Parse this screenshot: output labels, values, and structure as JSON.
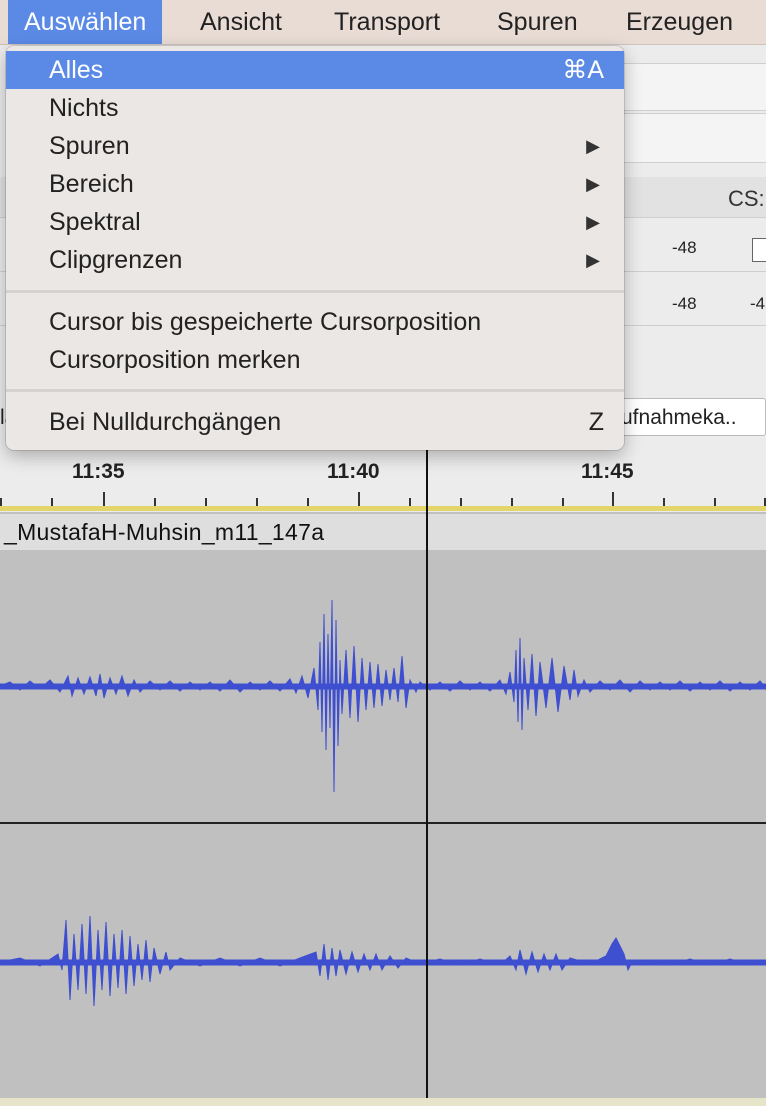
{
  "menubar": {
    "items": [
      {
        "label": "Auswählen",
        "active": true
      },
      {
        "label": "Ansicht"
      },
      {
        "label": "Transport"
      },
      {
        "label": "Spuren"
      },
      {
        "label": "Erzeugen"
      }
    ]
  },
  "dropdown": {
    "items": [
      {
        "label": "Alles",
        "shortcut": "⌘A",
        "highlighted": true
      },
      {
        "label": "Nichts"
      },
      {
        "label": "Spuren",
        "submenu": true
      },
      {
        "label": "Bereich",
        "submenu": true
      },
      {
        "label": "Spektral",
        "submenu": true
      },
      {
        "label": "Clipgrenzen",
        "submenu": true
      },
      {
        "label": "Cursor bis gespeicherte Cursorposition"
      },
      {
        "label": "Cursorposition merken"
      },
      {
        "label": "Bei Nulldurchgängen",
        "shortcut": "Z"
      }
    ],
    "submenu_arrow": "▶"
  },
  "toolbar": {
    "cs_label": "CS:",
    "meter_ticks": [
      "-48",
      "-48",
      "-4"
    ],
    "device_field": "ufnahmeka..",
    "left_fragment": "la"
  },
  "timeline": {
    "labels": [
      "11:35",
      "11:40",
      "11:45"
    ]
  },
  "track": {
    "clip_name": "_MustafaH-Muhsin_m11_147a"
  },
  "colors": {
    "accent": "#5b8ae6",
    "waveform": "#3e4fd0",
    "track_bg": "#c0c0c0"
  }
}
